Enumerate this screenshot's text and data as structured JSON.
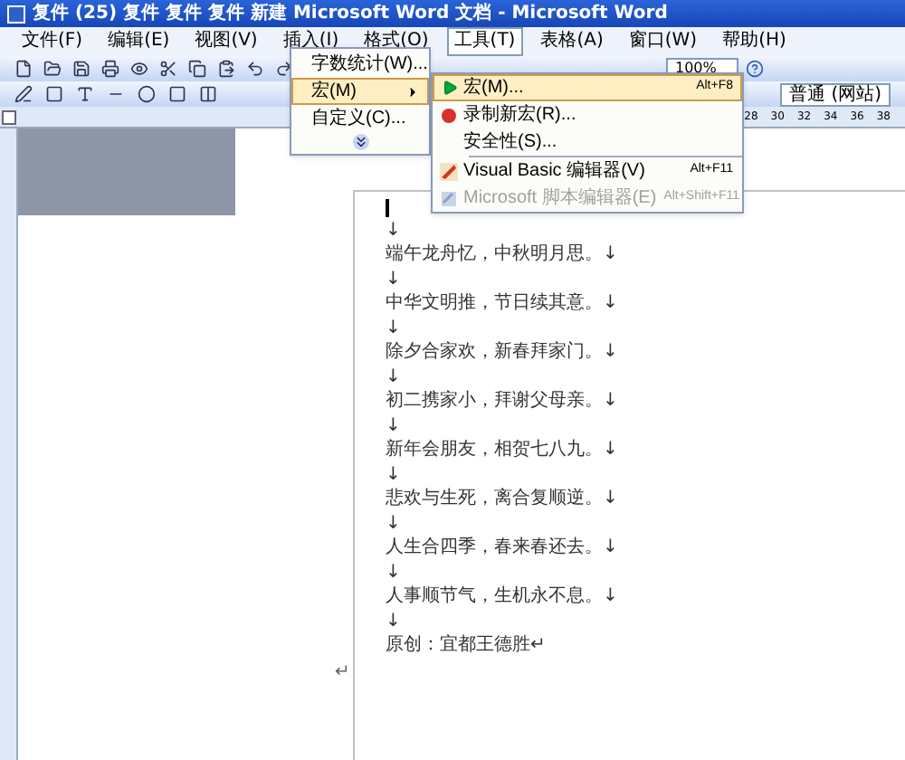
{
  "window": {
    "title": "复件 (25) 复件 复件 复件 新建 Microsoft Word 文档 - Microsoft Word"
  },
  "menu_bar": [
    {
      "label": "文件(F)",
      "selected": false
    },
    {
      "label": "编辑(E)",
      "selected": false
    },
    {
      "label": "视图(V)",
      "selected": false
    },
    {
      "label": "插入(I)",
      "selected": false
    },
    {
      "label": "格式(O)",
      "selected": false
    },
    {
      "label": "工具(T)",
      "selected": true
    },
    {
      "label": "表格(A)",
      "selected": false
    },
    {
      "label": "窗口(W)",
      "selected": false
    },
    {
      "label": "帮助(H)",
      "selected": false
    }
  ],
  "toolbar": {
    "zoom": "100%",
    "style": "普通 (网站)"
  },
  "ruler": {
    "ticks": [
      "28",
      "30",
      "32",
      "34",
      "36",
      "38"
    ]
  },
  "tools_menu": [
    {
      "label": "字数统计(W)...",
      "has_submenu": false,
      "selected": false
    },
    {
      "label": "宏(M)",
      "has_submenu": true,
      "selected": true
    },
    {
      "label": "自定义(C)...",
      "has_submenu": false,
      "selected": false
    }
  ],
  "macro_submenu": [
    {
      "label": "宏(M)...",
      "shortcut": "Alt+F8",
      "selected": true,
      "disabled": false,
      "separator_before": false
    },
    {
      "label": "录制新宏(R)...",
      "selected": false,
      "disabled": false,
      "separator_before": false
    },
    {
      "label": "安全性(S)...",
      "selected": false,
      "disabled": false,
      "separator_before": false
    },
    {
      "label": "Visual Basic 编辑器(V)",
      "shortcut": "Alt+F11",
      "selected": false,
      "disabled": false,
      "separator_before": true
    },
    {
      "label": "Microsoft 脚本编辑器(E)",
      "shortcut": "Alt+Shift+F11",
      "selected": false,
      "disabled": true,
      "separator_before": false
    }
  ],
  "document": {
    "lines": [
      "↓",
      "端午龙舟忆，中秋明月思。↓",
      "↓",
      "中华文明推，节日续其意。↓",
      "↓",
      "除夕合家欢，新春拜家门。↓",
      "↓",
      "初二携家小，拜谢父母亲。↓",
      "↓",
      "新年会朋友，相贺七八九。↓",
      "↓",
      "悲欢与生死，离合复顺逆。↓",
      "↓",
      "人生合四季，春来春还去。↓",
      "↓",
      "人事顺节气，生机永不息。↓",
      "↓",
      "原创：宜都王德胜↵"
    ],
    "end_mark": "↵"
  }
}
